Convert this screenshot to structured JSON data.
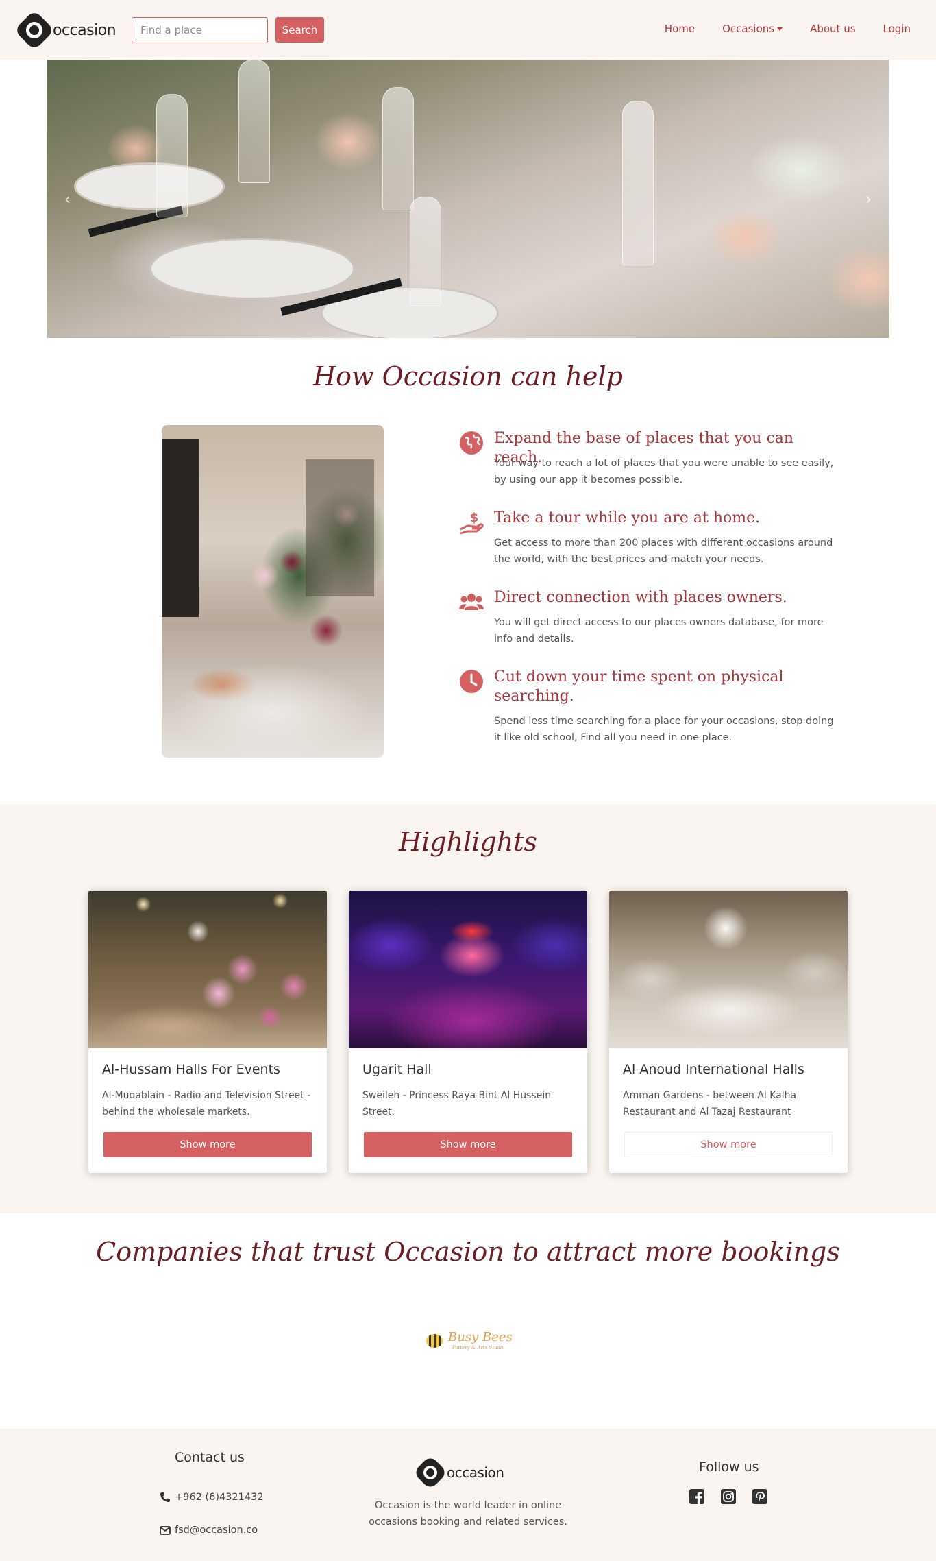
{
  "nav": {
    "brand": "occasion",
    "search_placeholder": "Find a place",
    "search_button": "Search",
    "links": {
      "home": "Home",
      "occasions": "Occasions",
      "about": "About us",
      "login": "Login"
    }
  },
  "hero": {
    "prev_icon": "‹",
    "next_icon": "›"
  },
  "how": {
    "title": "How Occasion can help",
    "features": [
      {
        "icon": "globe-icon",
        "title": "Expand the base of places that you can reach.",
        "text": "Your way to reach a lot of places that you were unable to see easily, by using our app it becomes possible."
      },
      {
        "icon": "hand-holding-dollar-icon",
        "title": "Take a tour while you are at home.",
        "text": "Get access to more than 200 places with different occasions around the world, with the best prices and match your needs."
      },
      {
        "icon": "users-icon",
        "title": "Direct connection with places owners.",
        "text": "You will get direct access to our places owners database, for more info and details."
      },
      {
        "icon": "clock-icon",
        "title": "Cut down your time spent on physical searching.",
        "text": "Spend less time searching for a place for your occasions, stop doing it like old school, Find all you need in one place."
      }
    ]
  },
  "highlights": {
    "title": "Highlights",
    "cards": [
      {
        "name": "Al-Hussam Halls For Events",
        "address": "Al-Muqablain - Radio and Television Street - behind the wholesale markets.",
        "button": "Show more"
      },
      {
        "name": "Ugarit Hall",
        "address": "Sweileh - Princess Raya Bint Al Hussein Street.",
        "button": "Show more"
      },
      {
        "name": "Al Anoud International Halls",
        "address": "Amman Gardens - between Al Kalha Restaurant and Al Tazaj Restaurant",
        "button": "Show more"
      }
    ]
  },
  "companies": {
    "title": "Companies that trust Occasion to attract more bookings",
    "logos": [
      {
        "name": "Busy Bees",
        "subtitle": "Pottery & Arts Studio"
      }
    ]
  },
  "footer": {
    "contact_title": "Contact us",
    "phone": "+962 (6)4321432",
    "email": "fsd@occasion.co",
    "brand": "occasion",
    "about": "Occasion is the world leader in online occasions booking and related services.",
    "follow_title": "Follow us",
    "social": [
      "facebook-icon",
      "instagram-icon",
      "pinterest-icon"
    ]
  },
  "colors": {
    "accent": "#d46062",
    "title": "#6b1f24",
    "feature_title": "#a4373c",
    "cream": "#faf5f1"
  }
}
